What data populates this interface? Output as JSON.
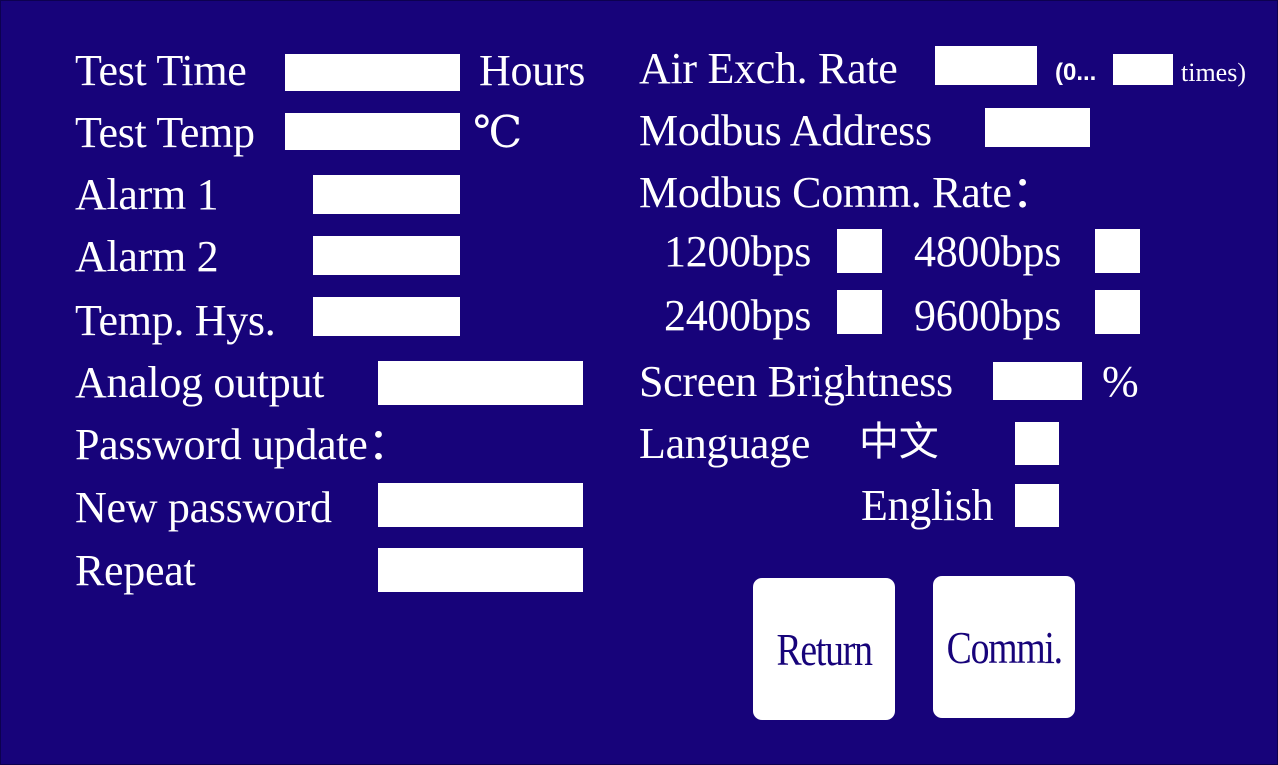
{
  "left": {
    "test_time": {
      "label": "Test Time",
      "unit": "Hours",
      "value": ""
    },
    "test_temp": {
      "label": "Test Temp",
      "unit": "℃",
      "value": ""
    },
    "alarm1": {
      "label": "Alarm 1",
      "value": ""
    },
    "alarm2": {
      "label": "Alarm 2",
      "value": ""
    },
    "temp_hys": {
      "label": "Temp. Hys.",
      "value": ""
    },
    "analog_output": {
      "label": "Analog output",
      "value": ""
    },
    "password_update": {
      "label": "Password update："
    },
    "new_password": {
      "label": "New password",
      "value": ""
    },
    "repeat": {
      "label": "Repeat",
      "value": ""
    }
  },
  "right": {
    "air_exch": {
      "label": "Air Exch. Rate",
      "value": "",
      "range_prefix": "(0...",
      "range_max": "",
      "range_suffix": "times)"
    },
    "modbus_address": {
      "label": "Modbus Address",
      "value": ""
    },
    "modbus_rate": {
      "label": "Modbus Comm. Rate：",
      "options": [
        "1200bps",
        "4800bps",
        "2400bps",
        "9600bps"
      ]
    },
    "brightness": {
      "label": "Screen Brightness",
      "unit": "%",
      "value": ""
    },
    "language": {
      "label": "Language",
      "options": [
        "中文",
        "English"
      ]
    }
  },
  "buttons": {
    "return_label": "Return",
    "commit_label": "Commi."
  },
  "colors": {
    "background": "#17037a",
    "field": "#ffffff",
    "text": "#ffffff",
    "button_text": "#17037a"
  }
}
